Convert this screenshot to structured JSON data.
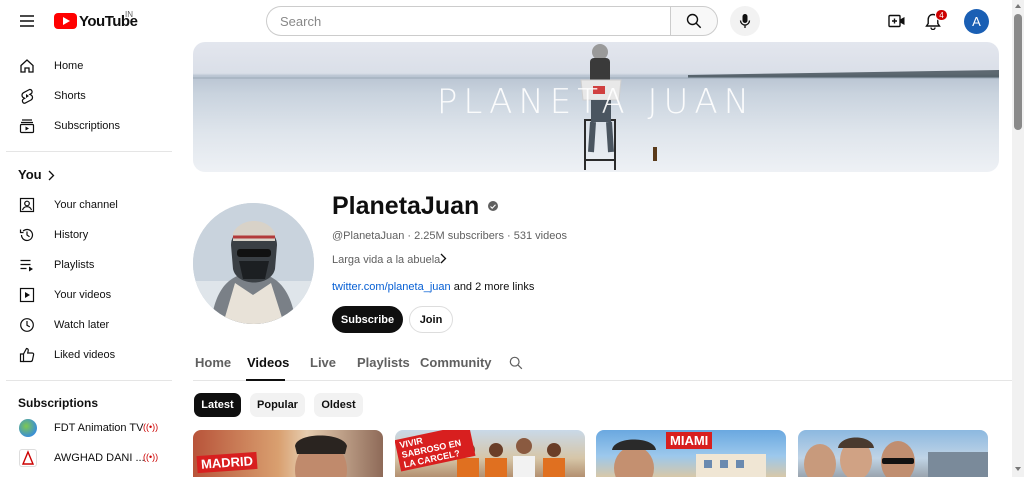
{
  "header": {
    "logo_text": "YouTube",
    "logo_region": "IN",
    "search_placeholder": "Search",
    "notification_count": "4",
    "avatar_letter": "A"
  },
  "sidebar": {
    "main": [
      {
        "label": "Home",
        "icon": "home-icon"
      },
      {
        "label": "Shorts",
        "icon": "shorts-icon"
      },
      {
        "label": "Subscriptions",
        "icon": "subscriptions-icon"
      }
    ],
    "you_heading": "You",
    "you": [
      {
        "label": "Your channel",
        "icon": "your-channel-icon"
      },
      {
        "label": "History",
        "icon": "history-icon"
      },
      {
        "label": "Playlists",
        "icon": "playlists-icon"
      },
      {
        "label": "Your videos",
        "icon": "your-videos-icon"
      },
      {
        "label": "Watch later",
        "icon": "watch-later-icon"
      },
      {
        "label": "Liked videos",
        "icon": "liked-videos-icon"
      }
    ],
    "subscriptions_heading": "Subscriptions",
    "subscriptions": [
      {
        "label": "FDT Animation TV",
        "live": true
      },
      {
        "label": "AWGHAD DANI ...",
        "live": true
      }
    ]
  },
  "channel": {
    "banner_title": "PLANETA JUAN",
    "name": "PlanetaJuan",
    "meta": "@PlanetaJuan · 2.25M subscribers · 531 videos",
    "description": "Larga vida a la abuela",
    "link": "twitter.com/planeta_juan",
    "more_links": " and 2 more links",
    "subscribe_label": "Subscribe",
    "join_label": "Join"
  },
  "tabs": [
    "Home",
    "Videos",
    "Live",
    "Playlists",
    "Community"
  ],
  "active_tab": "Videos",
  "chips": [
    "Latest",
    "Popular",
    "Oldest"
  ],
  "active_chip": "Latest",
  "thumbnails": [
    {
      "tag": "MADRID"
    },
    {
      "tag": "VIVIR SABROSO EN LA CARCEL?"
    },
    {
      "tag": "MIAMI"
    },
    {
      "tag": ""
    }
  ],
  "colors": {
    "brand": "#ff0000",
    "link": "#065fd4",
    "badge": "#cc0000",
    "avatar": "#1a5fb4"
  }
}
